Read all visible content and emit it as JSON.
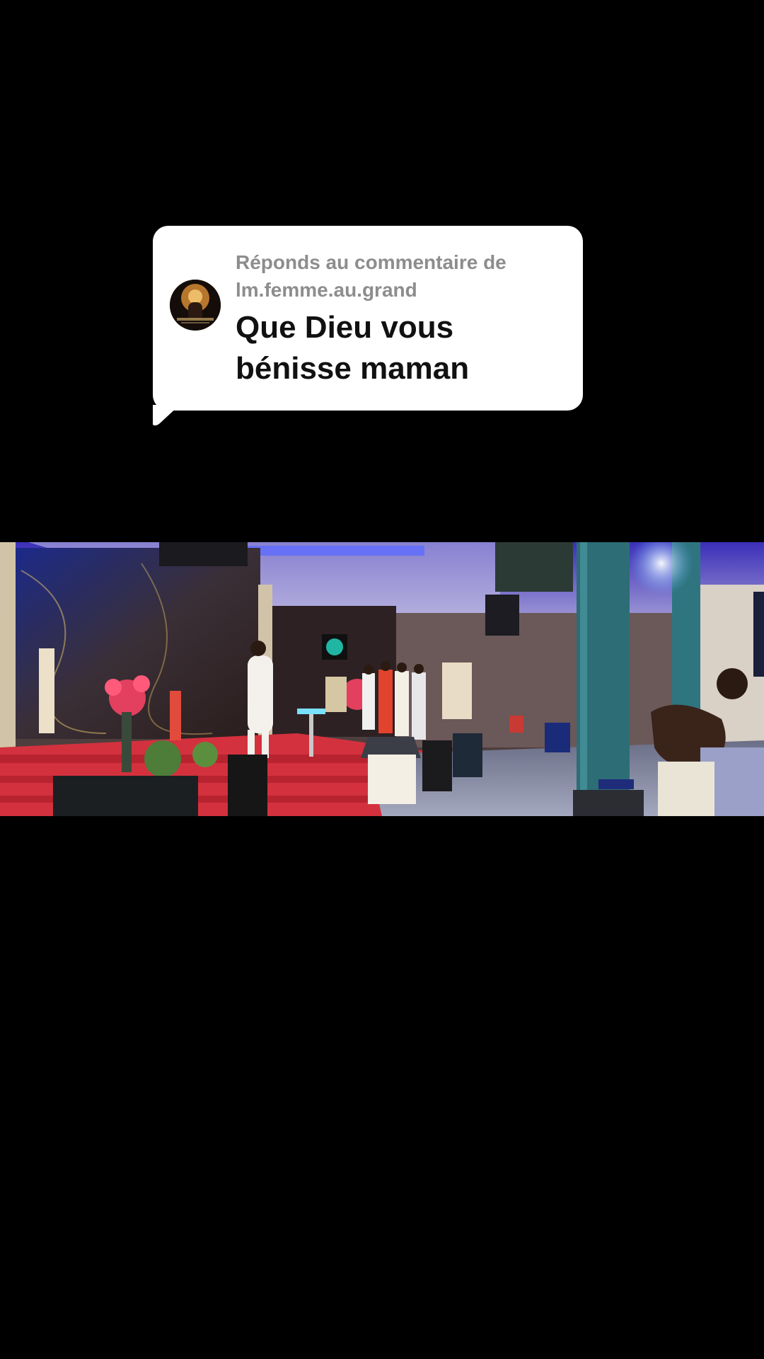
{
  "reply_sticker": {
    "header_line1": "Réponds au commentaire de",
    "header_line2": "lm.femme.au.grand",
    "comment_line1": "Que Dieu vous",
    "comment_line2": "bénisse maman",
    "avatar": "commenter-avatar"
  },
  "video": {
    "scene": "church-stage-performance"
  },
  "colors": {
    "background": "#000000",
    "card": "#ffffff",
    "meta_text": "#8d8d8d",
    "comment_text": "#111111"
  }
}
